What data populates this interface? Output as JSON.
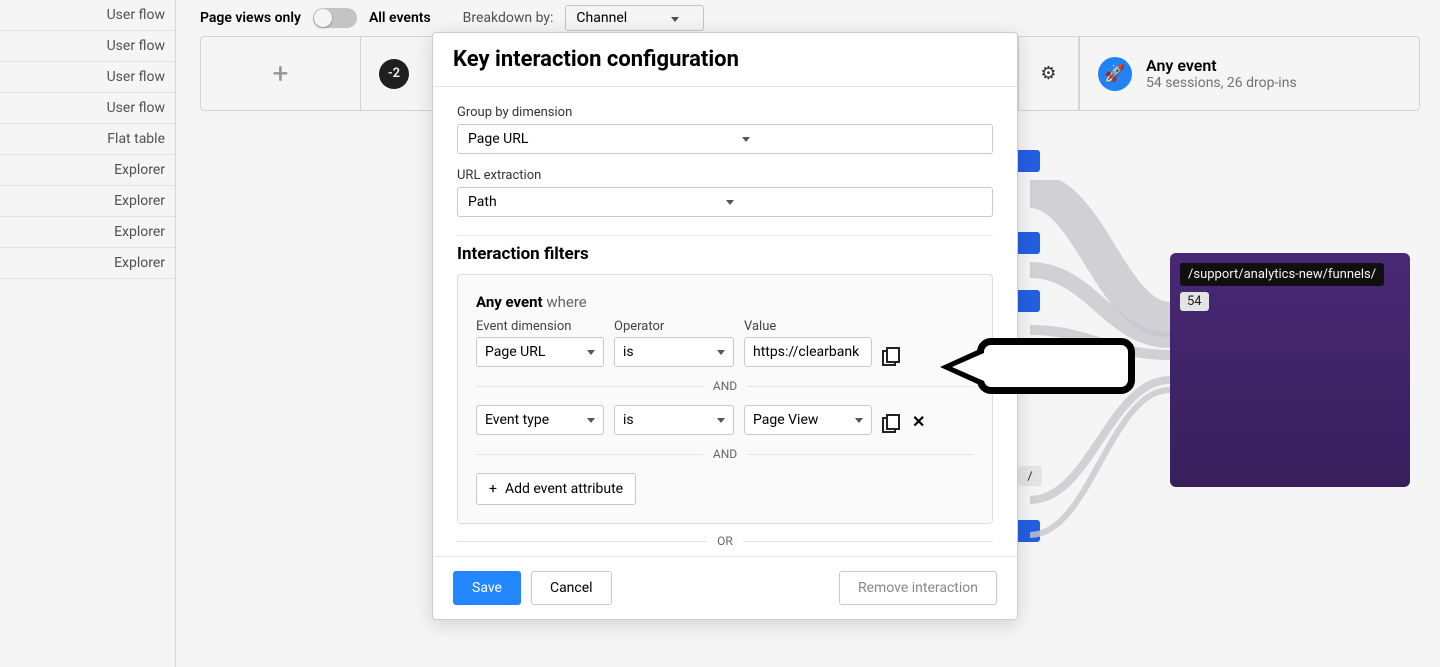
{
  "sidebar": {
    "items": [
      {
        "label": "User flow"
      },
      {
        "label": "User flow"
      },
      {
        "label": "User flow"
      },
      {
        "label": "User flow"
      },
      {
        "label": "Flat table"
      },
      {
        "label": "Explorer"
      },
      {
        "label": "Explorer"
      },
      {
        "label": "Explorer"
      },
      {
        "label": "Explorer"
      }
    ]
  },
  "topbar": {
    "page_views_label": "Page views only",
    "all_events_label": "All events",
    "breakdown_label": "Breakdown by:",
    "breakdown_value": "Channel"
  },
  "step_badge": "-2",
  "event_card": {
    "title": "Any event",
    "subtitle": "54 sessions, 26 drop-ins"
  },
  "flow_node": {
    "path": "/support/analytics-new/funnels/",
    "count": "54"
  },
  "modal": {
    "title": "Key interaction configuration",
    "group_by_label": "Group by dimension",
    "group_by_value": "Page URL",
    "url_extraction_label": "URL extraction",
    "url_extraction_value": "Path",
    "section_title": "Interaction filters",
    "any_event": "Any event",
    "where": "where",
    "col_dimension": "Event dimension",
    "col_operator": "Operator",
    "col_value": "Value",
    "rows": [
      {
        "dimension": "Page URL",
        "operator": "is",
        "value": "https://clearbank",
        "removable": false
      },
      {
        "dimension": "Event type",
        "operator": "is",
        "value": "Page View",
        "removable": true
      }
    ],
    "and_label": "AND",
    "or_label": "OR",
    "add_attr": "Add event attribute",
    "save": "Save",
    "cancel": "Cancel",
    "remove": "Remove interaction"
  }
}
